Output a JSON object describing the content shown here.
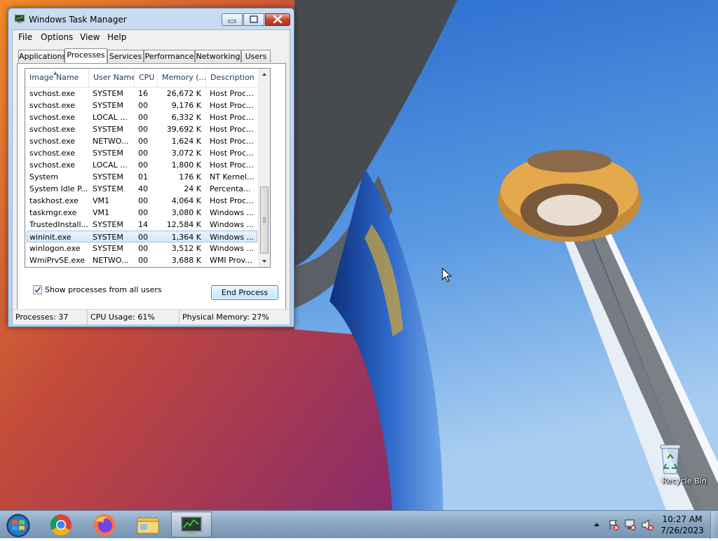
{
  "window": {
    "title": "Windows Task Manager",
    "menu": [
      "File",
      "Options",
      "View",
      "Help"
    ],
    "tabs": [
      {
        "label": "Applications",
        "active": false
      },
      {
        "label": "Processes",
        "active": true
      },
      {
        "label": "Services",
        "active": false
      },
      {
        "label": "Performance",
        "active": false
      },
      {
        "label": "Networking",
        "active": false
      },
      {
        "label": "Users",
        "active": false
      }
    ],
    "columns": [
      "Image Name",
      "User Name",
      "CPU",
      "Memory (...",
      "Description"
    ],
    "processes": [
      {
        "name": "svchost.exe",
        "user": "SYSTEM",
        "cpu": "16",
        "memory": "26,672 K",
        "description": "Host Proc..."
      },
      {
        "name": "svchost.exe",
        "user": "SYSTEM",
        "cpu": "00",
        "memory": "9,176 K",
        "description": "Host Proc..."
      },
      {
        "name": "svchost.exe",
        "user": "LOCAL ...",
        "cpu": "00",
        "memory": "6,332 K",
        "description": "Host Proc..."
      },
      {
        "name": "svchost.exe",
        "user": "SYSTEM",
        "cpu": "00",
        "memory": "39,692 K",
        "description": "Host Proc..."
      },
      {
        "name": "svchost.exe",
        "user": "NETWO...",
        "cpu": "00",
        "memory": "1,624 K",
        "description": "Host Proc..."
      },
      {
        "name": "svchost.exe",
        "user": "SYSTEM",
        "cpu": "00",
        "memory": "3,072 K",
        "description": "Host Proc..."
      },
      {
        "name": "svchost.exe",
        "user": "LOCAL ...",
        "cpu": "00",
        "memory": "1,800 K",
        "description": "Host Proc..."
      },
      {
        "name": "System",
        "user": "SYSTEM",
        "cpu": "01",
        "memory": "176 K",
        "description": "NT Kernel..."
      },
      {
        "name": "System Idle P...",
        "user": "SYSTEM",
        "cpu": "40",
        "memory": "24 K",
        "description": "Percenta..."
      },
      {
        "name": "taskhost.exe",
        "user": "VM1",
        "cpu": "00",
        "memory": "4,064 K",
        "description": "Host Proc..."
      },
      {
        "name": "taskmgr.exe",
        "user": "VM1",
        "cpu": "00",
        "memory": "3,080 K",
        "description": "Windows ..."
      },
      {
        "name": "TrustedInstall...",
        "user": "SYSTEM",
        "cpu": "14",
        "memory": "12,584 K",
        "description": "Windows ..."
      },
      {
        "name": "wininit.exe",
        "user": "SYSTEM",
        "cpu": "00",
        "memory": "1,364 K",
        "description": "Windows ...",
        "selected": true
      },
      {
        "name": "winlogon.exe",
        "user": "SYSTEM",
        "cpu": "00",
        "memory": "3,512 K",
        "description": "Windows ..."
      },
      {
        "name": "WmiPrvSE.exe",
        "user": "NETWO...",
        "cpu": "00",
        "memory": "3,688 K",
        "description": "WMI Prov..."
      }
    ],
    "show_all_label": "Show processes from all users",
    "show_all_checked": true,
    "end_process_label": "End Process",
    "status": {
      "processes": "Processes: 37",
      "cpu": "CPU Usage: 61%",
      "memory": "Physical Memory: 27%"
    }
  },
  "desktop": {
    "recycle_bin_label": "Recycle Bin"
  },
  "taskbar": {
    "pinned": [
      "start-orb-icon",
      "chrome-icon",
      "firefox-icon",
      "file-explorer-icon",
      "task-manager-icon"
    ],
    "active_item": "task-manager-icon",
    "clock_time": "10:27 AM",
    "clock_date": "7/26/2023"
  },
  "colors": {
    "sky": "#3d7fd6",
    "taskbar": "#8aa6c1",
    "selection": "#d5e6fa",
    "close_button": "#c9462c"
  }
}
